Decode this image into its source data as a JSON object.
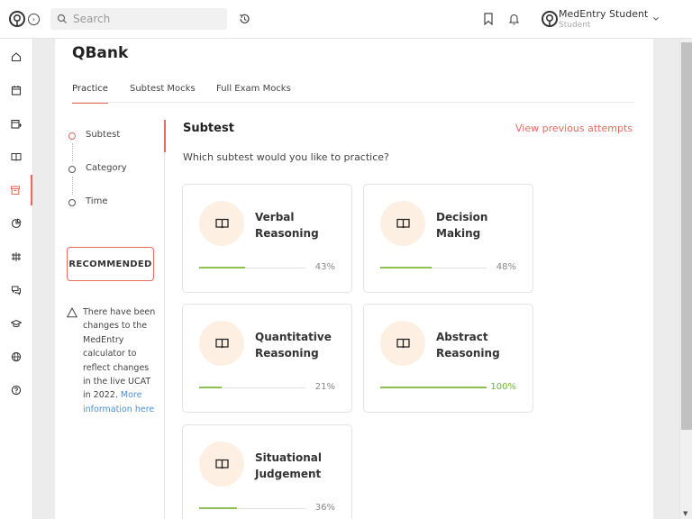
{
  "header": {
    "search_placeholder": "Search",
    "user_name": "MedEntry Student",
    "user_role": "Student"
  },
  "rail": {
    "items": [
      "home-icon",
      "calendar-icon",
      "calendar-add-icon",
      "book-icon",
      "archive-icon",
      "pie-chart-icon",
      "sliders-icon",
      "chat-icon",
      "graduation-cap-icon",
      "globe-icon",
      "help-icon"
    ],
    "active_index": 4
  },
  "page": {
    "title": "QBank",
    "tabs": [
      {
        "label": "Practice",
        "active": true
      },
      {
        "label": "Subtest Mocks",
        "active": false
      },
      {
        "label": "Full Exam Mocks",
        "active": false
      }
    ]
  },
  "steps": [
    {
      "label": "Subtest",
      "active": true
    },
    {
      "label": "Category",
      "active": false
    },
    {
      "label": "Time",
      "active": false
    }
  ],
  "recommended_label": "RECOMMENDED",
  "notice": {
    "text": "There have been changes to the MedEntry calculator to reflect changes in the live UCAT in 2022.",
    "link_text": "More information here"
  },
  "content": {
    "title": "Subtest",
    "previous_attempts": "View previous attempts",
    "question": "Which subtest would you like to practice?",
    "subtests": [
      {
        "name_line1": "Verbal",
        "name_line2": "Reasoning",
        "percent_label": "43%",
        "progress": 0.43
      },
      {
        "name_line1": "Decision",
        "name_line2": "Making",
        "percent_label": "48%",
        "progress": 0.48
      },
      {
        "name_line1": "Quantitative",
        "name_line2": "Reasoning",
        "percent_label": "21%",
        "progress": 0.21
      },
      {
        "name_line1": "Abstract",
        "name_line2": "Reasoning",
        "percent_label": "100%",
        "progress": 1.0
      },
      {
        "name_line1": "Situational",
        "name_line2": "Judgement",
        "percent_label": "36%",
        "progress": 0.36
      }
    ]
  },
  "colors": {
    "accent": "#e86b5f",
    "progress": "#8cc152",
    "icon_bg": "#fdf0e3",
    "link": "#4b8fd8"
  }
}
